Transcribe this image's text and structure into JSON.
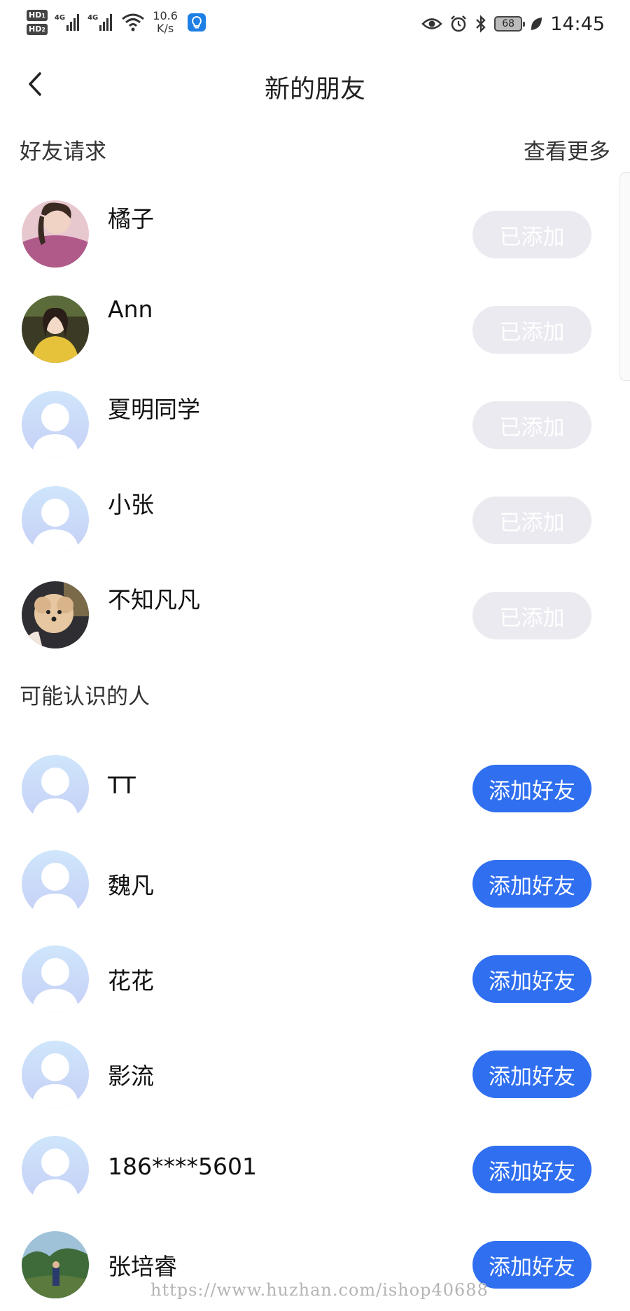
{
  "status_bar": {
    "hd1": "HD",
    "hd1_sub": "1",
    "hd2": "HD",
    "hd2_sub": "2",
    "net1": "4G",
    "net2": "4G",
    "speed_value": "10.6",
    "speed_unit": "K/s",
    "battery": "68",
    "time": "14:45"
  },
  "header": {
    "title": "新的朋友"
  },
  "friend_requests": {
    "label": "好友请求",
    "see_more": "查看更多",
    "items": [
      {
        "name": "橘子",
        "action": "已添加",
        "avatar": "photo-pink"
      },
      {
        "name": "Ann",
        "action": "已添加",
        "avatar": "photo-yellow"
      },
      {
        "name": "夏明同学",
        "action": "已添加",
        "avatar": "default-avatar"
      },
      {
        "name": "小张",
        "action": "已添加",
        "avatar": "default-avatar"
      },
      {
        "name": "不知凡凡",
        "action": "已添加",
        "avatar": "photo-dog"
      }
    ]
  },
  "suggestions": {
    "label": "可能认识的人",
    "items": [
      {
        "name": "TT",
        "action": "添加好友",
        "avatar": "default-avatar"
      },
      {
        "name": "魏凡",
        "action": "添加好友",
        "avatar": "default-avatar"
      },
      {
        "name": "花花",
        "action": "添加好友",
        "avatar": "default-avatar"
      },
      {
        "name": "影流",
        "action": "添加好友",
        "avatar": "default-avatar"
      },
      {
        "name": "186****5601",
        "action": "添加好友",
        "avatar": "default-avatar"
      },
      {
        "name": "张培睿",
        "action": "添加好友",
        "avatar": "photo-outdoor"
      }
    ]
  },
  "watermark": "https://www.huzhan.com/ishop40688",
  "colors": {
    "primary": "#2f6ff0",
    "added_bg": "#eaeaf0",
    "text": "#1a1a1a"
  }
}
